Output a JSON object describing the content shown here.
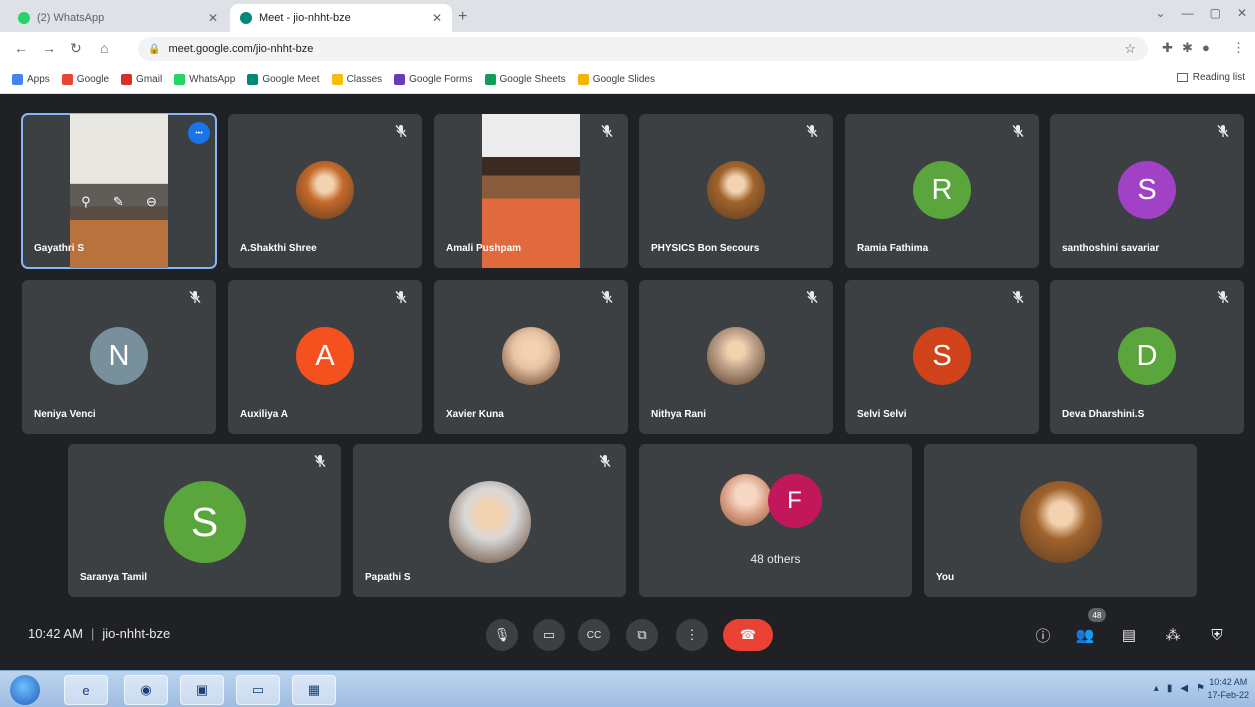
{
  "browser": {
    "tabs": [
      {
        "title": "(2) WhatsApp",
        "favicon": "whatsapp-icon",
        "color": "#25d366"
      },
      {
        "title": "Meet - jio-nhht-bze",
        "favicon": "meet-icon",
        "color": "#00897b"
      }
    ],
    "url": "meet.google.com/jio-nhht-bze",
    "bookmarks": [
      {
        "label": "Apps",
        "color": "#4285f4"
      },
      {
        "label": "Google",
        "color": "#ea4335"
      },
      {
        "label": "Gmail",
        "color": "#d93025"
      },
      {
        "label": "WhatsApp",
        "color": "#25d366"
      },
      {
        "label": "Google Meet",
        "color": "#00897b"
      },
      {
        "label": "Classes",
        "color": "#fbbc04"
      },
      {
        "label": "Google Forms",
        "color": "#673ab7"
      },
      {
        "label": "Google Sheets",
        "color": "#0f9d58"
      },
      {
        "label": "Google Slides",
        "color": "#f4b400"
      }
    ],
    "reading_list": "Reading list"
  },
  "participants": [
    {
      "name": "Gayathri S",
      "type": "video",
      "pinned": true
    },
    {
      "name": "A.Shakthi Shree",
      "type": "photo",
      "color": "#c56a2a"
    },
    {
      "name": "Amali Pushpam",
      "type": "video"
    },
    {
      "name": "PHYSICS Bon Secours",
      "type": "photo",
      "color": "#a0632c"
    },
    {
      "name": "Ramia Fathima",
      "type": "initial",
      "initial": "R",
      "color": "#5aa63c"
    },
    {
      "name": "santhoshini savariar",
      "type": "initial",
      "initial": "S",
      "color": "#a142c6"
    },
    {
      "name": "Neniya Venci",
      "type": "initial",
      "initial": "N",
      "color": "#78909c"
    },
    {
      "name": "Auxiliya A",
      "type": "initial",
      "initial": "A",
      "color": "#f4511e"
    },
    {
      "name": "Xavier Kuna",
      "type": "photo",
      "color": "#e9c3a4"
    },
    {
      "name": "Nithya Rani",
      "type": "photo",
      "color": "#bfa48c"
    },
    {
      "name": "Selvi Selvi",
      "type": "initial",
      "initial": "S",
      "color": "#d0431a"
    },
    {
      "name": "Deva Dharshini.S",
      "type": "initial",
      "initial": "D",
      "color": "#5aa63c"
    },
    {
      "name": "Saranya Tamil",
      "type": "initial",
      "initial": "S",
      "color": "#5aa63c"
    },
    {
      "name": "Papathi S",
      "type": "photo",
      "color": "#d8d8d8"
    },
    {
      "name": "",
      "type": "others",
      "initial": "F",
      "color": "#c2185b",
      "others_label": "48 others"
    },
    {
      "name": "You",
      "type": "photo",
      "color": "#a0632c"
    }
  ],
  "meeting": {
    "time": "10:42 AM",
    "code": "jio-nhht-bze",
    "participant_count": "48"
  },
  "taskbar": {
    "clock_time": "10:42 AM",
    "clock_date": "17-Feb-22"
  }
}
